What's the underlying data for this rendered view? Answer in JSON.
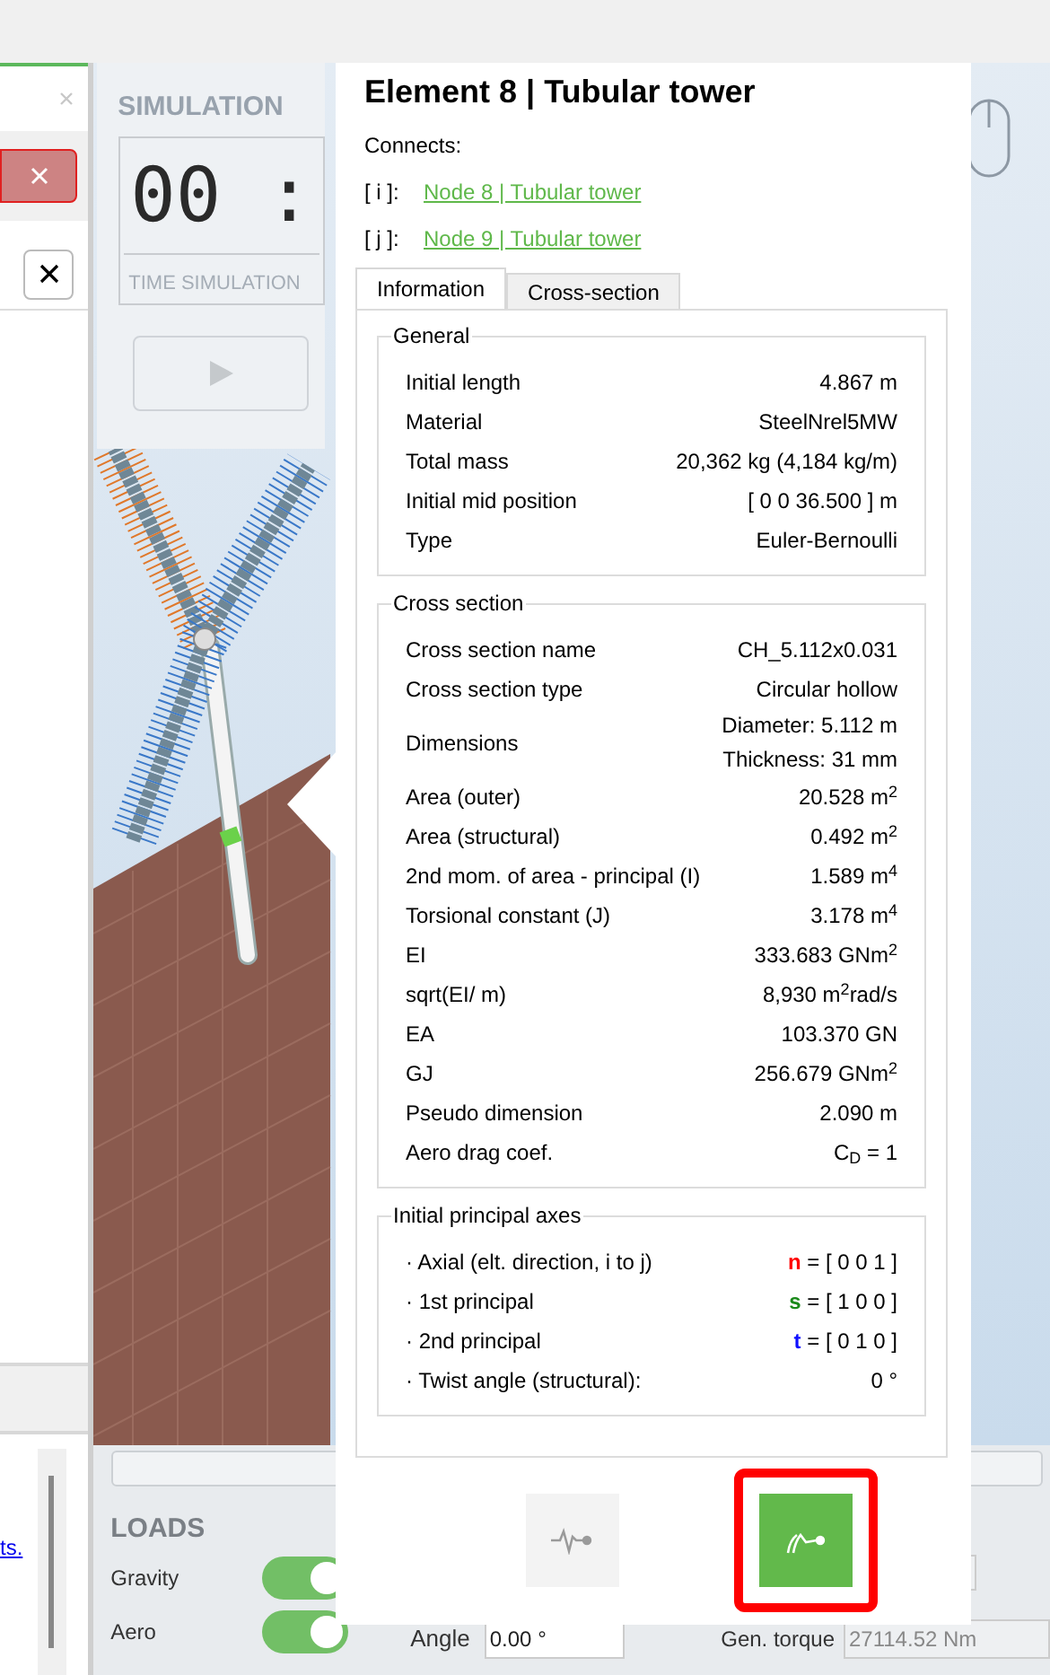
{
  "left_panel": {
    "link_fragment": "ts."
  },
  "simulation": {
    "title": "SIMULATION",
    "clock": "00 :",
    "clock_label": "TIME SIMULATION"
  },
  "loads": {
    "title": "LOADS",
    "toggles": [
      {
        "label": "Gravity",
        "on": true
      },
      {
        "label": "Aero",
        "on": true
      }
    ]
  },
  "angle": {
    "label": "Angle",
    "value": "0.00 °"
  },
  "gen_torque": {
    "label": "Gen. torque",
    "value": "27114.52 Nm"
  },
  "popup": {
    "title": "Element 8 | Tubular tower",
    "connects_label": "Connects:",
    "connections": [
      {
        "key": "[ i ]:",
        "label": "Node 8 | Tubular tower"
      },
      {
        "key": "[ j ]:",
        "label": "Node 9 | Tubular tower"
      }
    ],
    "tabs": [
      {
        "label": "Information",
        "selected": true
      },
      {
        "label": "Cross-section",
        "selected": false
      }
    ],
    "sections": [
      {
        "title": "General",
        "rows": [
          {
            "label": "Initial length",
            "value": "4.867 m"
          },
          {
            "label": "Material",
            "value": "SteelNrel5MW"
          },
          {
            "label": "Total mass",
            "value": "20,362 kg (4,184 kg/m)"
          },
          {
            "label": "Initial mid position",
            "value": "[ 0 0 36.500 ] m"
          },
          {
            "label": "Type",
            "value": "Euler-Bernoulli"
          }
        ]
      },
      {
        "title": "Cross section",
        "rows": [
          {
            "label": "Cross section name",
            "value": "CH_5.112x0.031"
          },
          {
            "label": "Cross section type",
            "value": "Circular hollow"
          },
          {
            "label": "Dimensions",
            "value_lines": [
              "Diameter: 5.112 m",
              "Thickness: 31 mm"
            ]
          },
          {
            "label": "Area (outer)",
            "value": "20.528 m$^{2}$"
          },
          {
            "label": "Area (structural)",
            "value": "0.492 m$^{2}$"
          },
          {
            "label": "2nd mom. of area - principal (I)",
            "value": "1.589 m$^{4}$"
          },
          {
            "label": "Torsional constant (J)",
            "value": "3.178 m$^{4}$"
          },
          {
            "label": "EI",
            "value": "333.683 GNm$^{2}$"
          },
          {
            "label": "sqrt(EI/ m)",
            "value": "8,930 m$^{2}$rad/s"
          },
          {
            "label": "EA",
            "value": "103.370  GN"
          },
          {
            "label": "GJ",
            "value": "256.679 GNm$^{2}$"
          },
          {
            "label": "Pseudo dimension",
            "value": "2.090 m"
          },
          {
            "label": "Aero drag coef.",
            "value": "C$_{D}$ = 1"
          }
        ]
      },
      {
        "title": "Initial principal axes",
        "rows": [
          {
            "label": "· Axial (elt. direction, i to j)",
            "symbol": "n",
            "color": "#ff0000",
            "value": "= [ 0 0 1 ]"
          },
          {
            "label": "· 1st principal",
            "symbol": "s",
            "color": "#1a8a1a",
            "value": "= [ 1 0 0 ]"
          },
          {
            "label": "· 2nd principal",
            "symbol": "t",
            "color": "#1010ff",
            "value": "= [ 0 1 0 ]"
          },
          {
            "label": "· Twist angle (structural):",
            "value": "0 °"
          }
        ]
      }
    ],
    "view_buttons": [
      {
        "kind": "modes",
        "selected": false
      },
      {
        "kind": "deformed",
        "selected": true
      }
    ]
  }
}
